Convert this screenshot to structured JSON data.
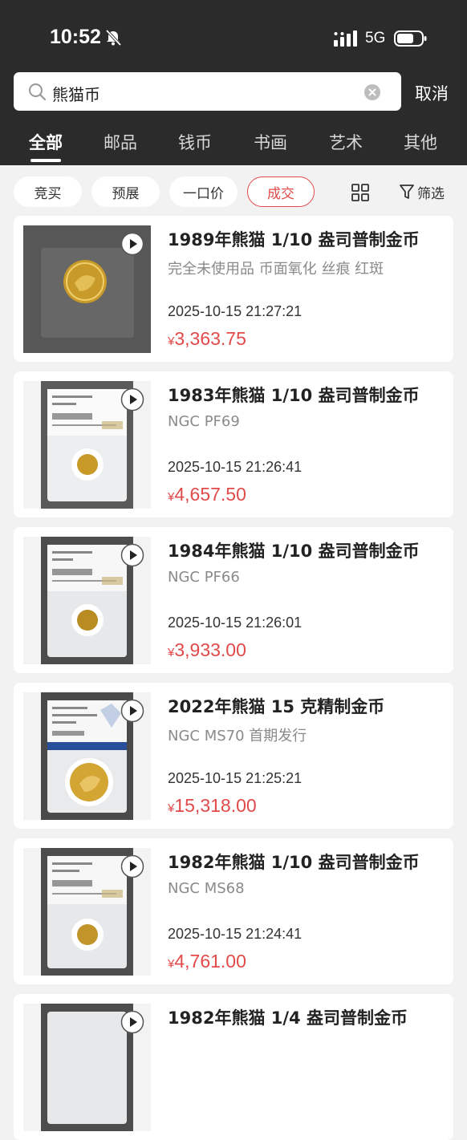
{
  "status_bar": {
    "time": "10:52",
    "network": "5G"
  },
  "search": {
    "query": "熊猫币",
    "cancel_label": "取消"
  },
  "tabs": [
    {
      "label": "全部",
      "active": true
    },
    {
      "label": "邮品",
      "active": false
    },
    {
      "label": "钱币",
      "active": false
    },
    {
      "label": "书画",
      "active": false
    },
    {
      "label": "艺术",
      "active": false
    },
    {
      "label": "其他",
      "active": false
    }
  ],
  "filters": {
    "chips": [
      {
        "label": "竞买",
        "active": false
      },
      {
        "label": "预展",
        "active": false
      },
      {
        "label": "一口价",
        "active": false
      },
      {
        "label": "成交",
        "active": true
      }
    ],
    "filter_label": "筛选"
  },
  "colors": {
    "header_bg": "#2b2b2b",
    "accent_red": "#e24a4a",
    "page_bg": "#f2f2f2"
  },
  "items": [
    {
      "title": "1989年熊猫 1/10 盎司普制金币",
      "subtitle": "完全未使用品 币面氧化 丝痕 红斑",
      "time": "2025-10-15 21:27:21",
      "currency": "¥",
      "price": "3,363.75",
      "image": "coin-in-plastic"
    },
    {
      "title": "1983年熊猫 1/10 盎司普制金币",
      "subtitle": "NGC PF69",
      "time": "2025-10-15 21:26:41",
      "currency": "¥",
      "price": "4,657.50",
      "image": "ngc-slab"
    },
    {
      "title": "1984年熊猫 1/10 盎司普制金币",
      "subtitle": "NGC PF66",
      "time": "2025-10-15 21:26:01",
      "currency": "¥",
      "price": "3,933.00",
      "image": "ngc-slab"
    },
    {
      "title": "2022年熊猫 15 克精制金币",
      "subtitle": "NGC MS70 首期发行",
      "time": "2025-10-15 21:25:21",
      "currency": "¥",
      "price": "15,318.00",
      "image": "ngc-slab-large"
    },
    {
      "title": "1982年熊猫 1/10 盎司普制金币",
      "subtitle": "NGC MS68",
      "time": "2025-10-15 21:24:41",
      "currency": "¥",
      "price": "4,761.00",
      "image": "ngc-slab"
    },
    {
      "title": "1982年熊猫 1/4 盎司普制金币",
      "subtitle": "",
      "time": "",
      "currency": "",
      "price": "",
      "image": "ngc-slab"
    }
  ]
}
